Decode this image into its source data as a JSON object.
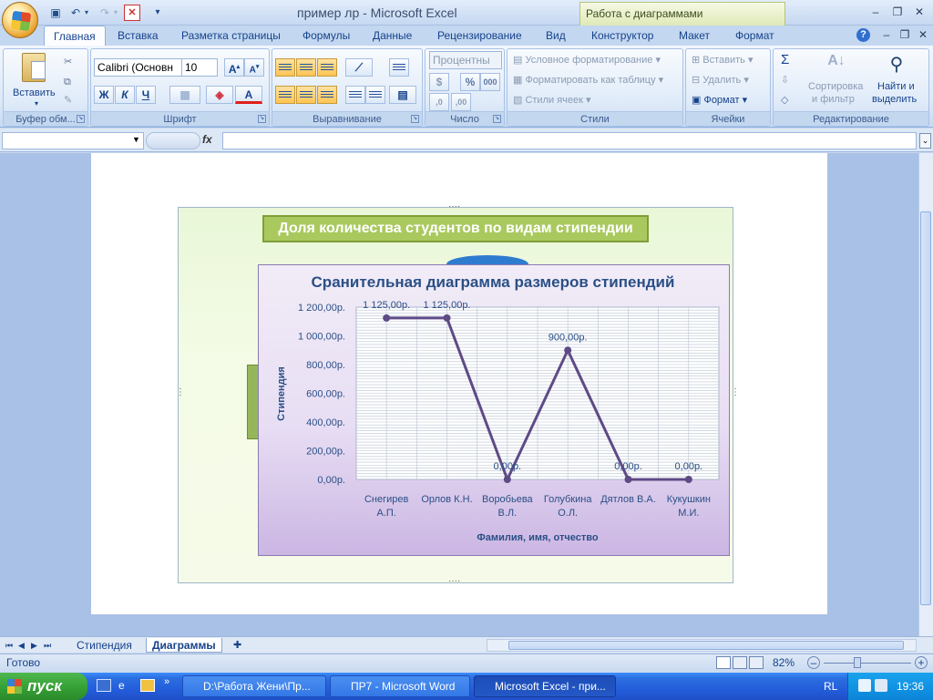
{
  "window": {
    "title": "пример лр - Microsoft Excel",
    "contextual_tab_title": "Работа с диаграммами"
  },
  "tabs": [
    "Главная",
    "Вставка",
    "Разметка страницы",
    "Формулы",
    "Данные",
    "Рецензирование",
    "Вид",
    "Конструктор",
    "Макет",
    "Формат"
  ],
  "ribbon": {
    "clipboard": {
      "paste": "Вставить",
      "group": "Буфер обм..."
    },
    "font": {
      "name": "Calibri (Основн",
      "size": "10",
      "bold": "Ж",
      "italic": "К",
      "underline": "Ч",
      "color_glyph": "А",
      "group": "Шрифт"
    },
    "alignment": {
      "group": "Выравнивание"
    },
    "number": {
      "format": "Процентны",
      "percent": "%",
      "thousands": "000",
      "group": "Число"
    },
    "styles": {
      "conditional": "Условное форматирование",
      "as_table": "Форматировать как таблицу",
      "cell_styles": "Стили ячеек",
      "group": "Стили"
    },
    "cells": {
      "insert": "Вставить",
      "delete": "Удалить",
      "format": "Формат",
      "group": "Ячейки"
    },
    "editing": {
      "sum": "Σ",
      "sort_1": "Сортировка",
      "sort_2": "и фильтр",
      "find_1": "Найти и",
      "find_2": "выделить",
      "group": "Редактирование"
    }
  },
  "formula_bar": {
    "fx": "fx",
    "name": "",
    "value": ""
  },
  "outer_chart": {
    "title": "Доля количества студентов по видам стипендии"
  },
  "chart_data": {
    "type": "line",
    "title": "Сранительная диаграмма размеров стипендий",
    "xlabel": "Фамилия, имя, отчество",
    "ylabel": "Стипендия",
    "categories": [
      "Снегирев А.П.",
      "Орлов К.Н.",
      "Воробьева В.Л.",
      "Голубкина О.Л.",
      "Дятлов В.А.",
      "Кукушкин М.И."
    ],
    "category_lines": [
      [
        "Снегирев",
        "А.П."
      ],
      [
        "Орлов К.Н."
      ],
      [
        "Воробьева",
        "В.Л."
      ],
      [
        "Голубкина",
        "О.Л."
      ],
      [
        "Дятлов В.А."
      ],
      [
        "Кукушкин",
        "М.И."
      ]
    ],
    "values": [
      1125,
      1125,
      0,
      900,
      0,
      0
    ],
    "data_labels": [
      "1 125,00р.",
      "1 125,00р.",
      "0,00р.",
      "900,00р.",
      "0,00р.",
      "0,00р."
    ],
    "y_ticks": [
      "0,00р.",
      "200,00р.",
      "400,00р.",
      "600,00р.",
      "800,00р.",
      "1 000,00р.",
      "1 200,00р."
    ],
    "ylim": [
      0,
      1200
    ],
    "grid": true,
    "legend": "none",
    "line_color": "#5e4a86"
  },
  "sheet_tabs": [
    "Стипендия",
    "Диаграммы"
  ],
  "status": {
    "ready": "Готово",
    "zoom": "82%"
  },
  "taskbar": {
    "start": "пуск",
    "tasks": [
      "D:\\Работа Жени\\Пр...",
      "ПР7 - Microsoft Word",
      "Microsoft Excel - при..."
    ],
    "lang": "RL",
    "time": "19:36"
  }
}
